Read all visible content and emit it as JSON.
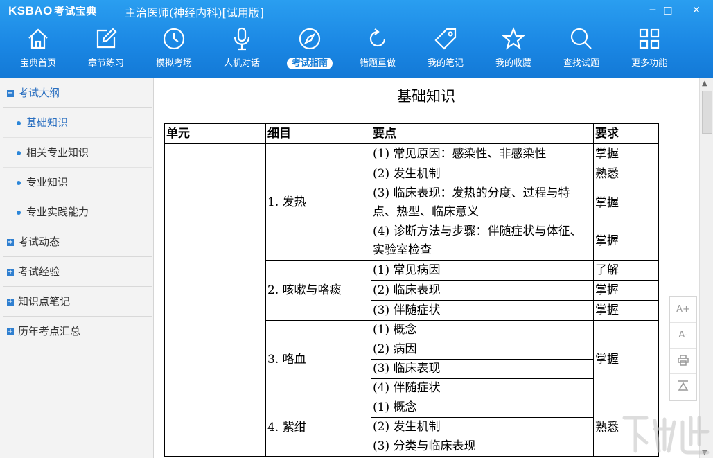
{
  "app": {
    "logo_text": "KSBAO",
    "logo_cn": "考试宝典",
    "window_title": "主治医师(神经内科)[试用版]",
    "window_controls": [
      "─",
      "□",
      "✕"
    ]
  },
  "nav": {
    "items": [
      {
        "label": "宝典首页",
        "icon": "home-icon"
      },
      {
        "label": "章节练习",
        "icon": "edit-icon"
      },
      {
        "label": "模拟考场",
        "icon": "clock-icon"
      },
      {
        "label": "人机对话",
        "icon": "microphone-icon"
      },
      {
        "label": "考试指南",
        "icon": "compass-icon",
        "active": true
      },
      {
        "label": "错题重做",
        "icon": "refresh-icon"
      },
      {
        "label": "我的笔记",
        "icon": "tag-icon"
      },
      {
        "label": "我的收藏",
        "icon": "star-icon"
      },
      {
        "label": "查找试题",
        "icon": "search-icon"
      },
      {
        "label": "更多功能",
        "icon": "grid-icon"
      }
    ]
  },
  "sidebar": {
    "open_category": {
      "label": "考试大纲",
      "toggle": "−"
    },
    "subitems": [
      "基础知识",
      "相关专业知识",
      "专业知识",
      "专业实践能力"
    ],
    "active_subitem": "基础知识",
    "categories": [
      {
        "label": "考试动态",
        "toggle": "+"
      },
      {
        "label": "考试经验",
        "toggle": "+"
      },
      {
        "label": "知识点笔记",
        "toggle": "+"
      },
      {
        "label": "历年考点汇总",
        "toggle": "+"
      }
    ]
  },
  "document": {
    "title": "基础知识",
    "headers": [
      "单元",
      "细目",
      "要点",
      "要求"
    ],
    "unit": "",
    "groups": [
      {
        "item": "1. 发热",
        "points": [
          {
            "text": "(1) 常见原因：感染性、非感染性",
            "req": "掌握"
          },
          {
            "text": "(2) 发生机制",
            "req": "熟悉"
          },
          {
            "text": "(3) 临床表现：发热的分度、过程与特点、热型、临床意义",
            "req": "掌握"
          },
          {
            "text": "(4) 诊断方法与步骤：伴随症状与体征、实验室检查",
            "req": "掌握"
          }
        ]
      },
      {
        "item": "2. 咳嗽与咯痰",
        "points": [
          {
            "text": "(1) 常见病因",
            "req": "了解"
          },
          {
            "text": "(2) 临床表现",
            "req": "掌握"
          },
          {
            "text": "(3) 伴随症状",
            "req": "掌握"
          }
        ]
      },
      {
        "item": "3. 咯血",
        "merged_req": "掌握",
        "points": [
          {
            "text": "(1) 概念"
          },
          {
            "text": "(2) 病因"
          },
          {
            "text": "(3) 临床表现"
          },
          {
            "text": "(4) 伴随症状"
          }
        ]
      },
      {
        "item": "4. 紫绀",
        "merged_req": "熟悉",
        "points": [
          {
            "text": "(1) 概念"
          },
          {
            "text": "(2) 发生机制"
          },
          {
            "text": "(3) 分类与临床表现"
          }
        ]
      }
    ]
  },
  "tools": {
    "font_increase": "A+",
    "font_decrease": "A-",
    "print_icon": "print-icon",
    "top_icon": "back-to-top-icon"
  },
  "colors": {
    "toolbar_blue": "#1a86e3",
    "accent": "#2a6fc0"
  }
}
